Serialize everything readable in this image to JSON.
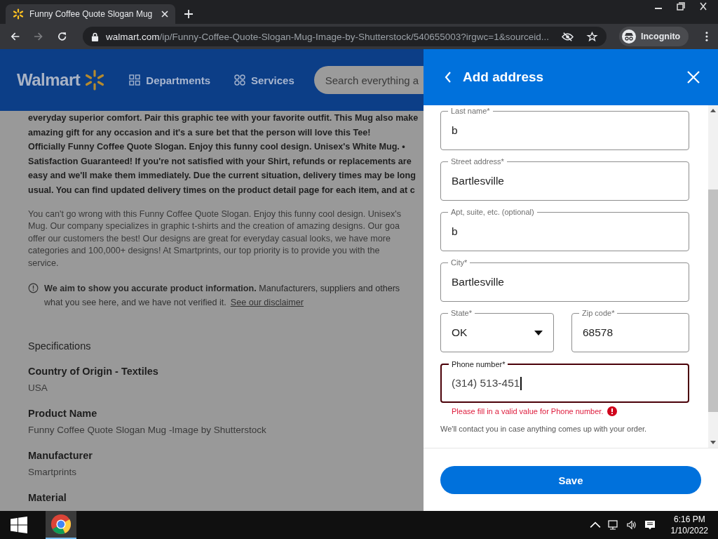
{
  "browser": {
    "tab_title": "Funny Coffee Quote Slogan Mug",
    "url_domain": "walmart.com",
    "url_path": "/ip/Funny-Coffee-Quote-Slogan-Mug-Image-by-Shutterstock/540655003?irgwc=1&sourceid...",
    "profile": "Incognito"
  },
  "site_header": {
    "logo": "Walmart",
    "nav": [
      {
        "label": "Departments",
        "kind": "grid"
      },
      {
        "label": "Services",
        "kind": "circles"
      }
    ],
    "search": {
      "placeholder": "Search everything a"
    }
  },
  "description": {
    "bold_lines": [
      "everyday superior comfort. Pair this graphic tee with your favorite outfit. This Mug also make",
      "amazing gift for any occasion and it's a sure bet that the person will love this Tee!",
      "Officially Funny Coffee Quote Slogan. Enjoy this funny cool design. Unisex's White Mug. •",
      "Satisfaction Guaranteed! If you're not satisfied with your Shirt, refunds or replacements are",
      "easy and we'll make them immediately. Due the current situation, delivery times may be long",
      "usual. You can find updated delivery times on the product detail page for each item, and at c"
    ],
    "lines": [
      "You can't go wrong with this Funny Coffee Quote Slogan. Enjoy this funny cool design. Unisex's",
      "Mug. Our company specializes in graphic t-shirts and the creation of amazing designs. Our goa",
      "offer our customers the best! Our designs are great for everyday casual looks, we have more",
      "categories and 100,000+ designs! At Smartprints, our top priority is to provide you with the",
      "service."
    ]
  },
  "notice": {
    "line1": "**We aim to show you accurate product information.** Manufacturers, suppliers and others",
    "line2": "what you see here, and we have not verified it.",
    "link": "See our disclaimer"
  },
  "specifications": {
    "title": "Specifications",
    "items": [
      {
        "label": "Country of Origin - Textiles",
        "value": "USA"
      },
      {
        "label": "Product Name",
        "value": "Funny Coffee Quote Slogan Mug -Image by Shutterstock"
      },
      {
        "label": "Manufacturer",
        "value": "Smartprints"
      },
      {
        "label": "Material"
      }
    ]
  },
  "drawer": {
    "title": "Add address",
    "rows": [
      [
        {
          "label": "Last name*",
          "value": "b",
          "kind": "text",
          "invalid": false,
          "focused": false
        }
      ],
      [
        {
          "label": "Street address*",
          "value": "Bartlesville",
          "kind": "text",
          "invalid": false,
          "focused": false
        }
      ],
      [
        {
          "label": "Apt, suite, etc. (optional)",
          "value": "b",
          "kind": "text",
          "invalid": false,
          "focused": false
        }
      ],
      [
        {
          "label": "City*",
          "value": "Bartlesville",
          "kind": "text",
          "invalid": false,
          "focused": false
        }
      ],
      [
        {
          "label": "State*",
          "value": "OK",
          "kind": "select",
          "invalid": false,
          "focused": false
        },
        {
          "label": "Zip code*",
          "value": "68578",
          "kind": "text",
          "invalid": false,
          "focused": false
        }
      ],
      [
        {
          "label": "Phone number*",
          "value": "(314) 513-451",
          "kind": "text",
          "invalid": true,
          "focused": true,
          "error": "Please fill in a valid value for Phone number."
        }
      ]
    ],
    "helper": "We'll contact you in case anything comes up with your order.",
    "save": "Save"
  },
  "taskbar": {
    "time": "6:16 PM",
    "date": "1/10/2022"
  }
}
